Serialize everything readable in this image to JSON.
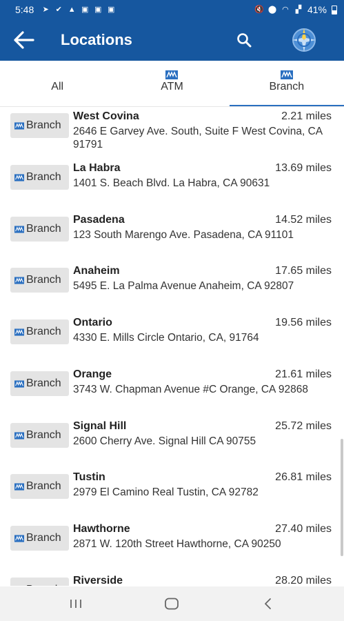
{
  "status_bar": {
    "time": "5:48",
    "battery": "41%"
  },
  "header": {
    "title": "Locations"
  },
  "tabs": [
    {
      "label": "All",
      "active": false,
      "has_icon": false
    },
    {
      "label": "ATM",
      "active": false,
      "has_icon": true
    },
    {
      "label": "Branch",
      "active": true,
      "has_icon": true
    }
  ],
  "locations": [
    {
      "type": "Branch",
      "name": "West Covina",
      "distance": "2.21 miles",
      "address": "2646 E Garvey Ave. South, Suite F West Covina, CA 91791"
    },
    {
      "type": "Branch",
      "name": "La Habra",
      "distance": "13.69 miles",
      "address": "1401 S. Beach Blvd. La Habra, CA 90631"
    },
    {
      "type": "Branch",
      "name": "Pasadena",
      "distance": "14.52 miles",
      "address": "123 South Marengo Ave. Pasadena, CA 91101"
    },
    {
      "type": "Branch",
      "name": "Anaheim",
      "distance": "17.65 miles",
      "address": "5495 E. La Palma Avenue Anaheim, CA 92807"
    },
    {
      "type": "Branch",
      "name": "Ontario",
      "distance": "19.56 miles",
      "address": "4330 E. Mills Circle Ontario, CA, 91764"
    },
    {
      "type": "Branch",
      "name": "Orange",
      "distance": "21.61 miles",
      "address": "3743 W. Chapman Avenue #C Orange, CA 92868"
    },
    {
      "type": "Branch",
      "name": "Signal Hill",
      "distance": "25.72 miles",
      "address": "2600 Cherry Ave. Signal Hill CA 90755"
    },
    {
      "type": "Branch",
      "name": "Tustin",
      "distance": "26.81 miles",
      "address": "2979 El Camino Real Tustin, CA 92782"
    },
    {
      "type": "Branch",
      "name": "Hawthorne",
      "distance": "27.40 miles",
      "address": "2871 W. 120th Street Hawthorne, CA 90250"
    },
    {
      "type": "Branch",
      "name": "Riverside",
      "distance": "28.20 miles",
      "address": ""
    }
  ],
  "colors": {
    "brand_blue": "#16579f",
    "tab_indicator": "#2a6fc0",
    "badge_bg": "#e4e4e4"
  },
  "icons": {
    "back": "arrow-left-icon",
    "search": "search-icon",
    "map": "map-compass-icon",
    "location_logo": "bank-logo-icon",
    "nav_recents": "recents-icon",
    "nav_home": "home-icon",
    "nav_back": "nav-back-icon"
  }
}
